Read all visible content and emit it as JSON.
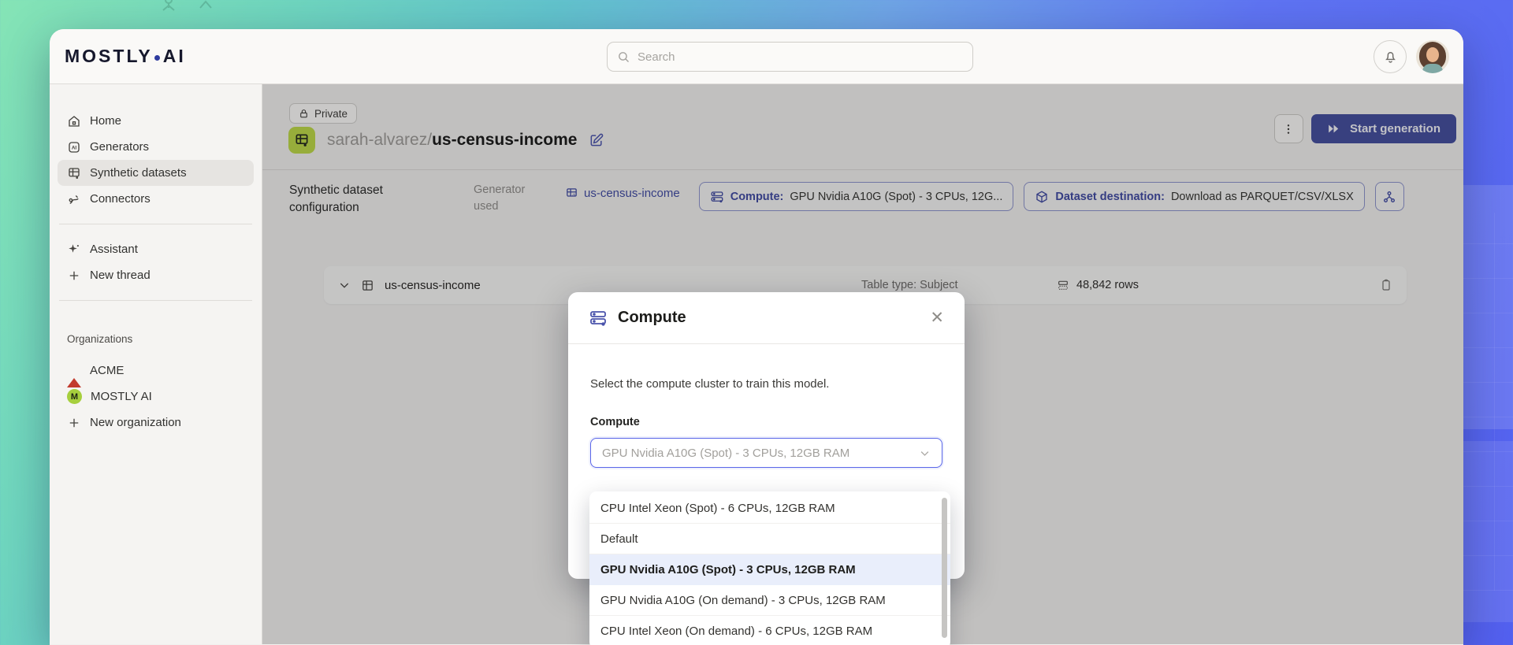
{
  "topbar": {
    "logo_left": "MOSTLY",
    "logo_right": "AI",
    "search_placeholder": "Search"
  },
  "sidebar": {
    "items": [
      {
        "label": "Home",
        "icon": "home-icon"
      },
      {
        "label": "Generators",
        "icon": "generators-icon"
      },
      {
        "label": "Synthetic datasets",
        "icon": "synthetic-datasets-icon",
        "active": true
      },
      {
        "label": "Connectors",
        "icon": "connectors-icon"
      }
    ],
    "assistant": {
      "label": "Assistant"
    },
    "new_thread": {
      "label": "New thread"
    },
    "organizations_label": "Organizations",
    "organizations": [
      {
        "label": "ACME",
        "badge": "acme-logo"
      },
      {
        "label": "MOSTLY AI",
        "badge": "M"
      }
    ],
    "new_organization": "New organization"
  },
  "page": {
    "privacy_badge": "Private",
    "title_owner": "sarah-alvarez/",
    "title_name": "us-census-income",
    "start_button": "Start generation",
    "config_heading": "Synthetic dataset configuration",
    "generator_used_label": "Generator used",
    "generator_link": "us-census-income",
    "compute_chip_label": "Compute:",
    "compute_chip_value": "GPU Nvidia A10G (Spot) - 3 CPUs, 12G...",
    "destination_chip_label": "Dataset destination:",
    "destination_chip_value": "Download as PARQUET/CSV/XLSX"
  },
  "table_row": {
    "name": "us-census-income",
    "type": "Table type: Subject",
    "rows": "48,842 rows"
  },
  "modal": {
    "title": "Compute",
    "close": "✕",
    "description": "Select the compute cluster to train this model.",
    "field_label": "Compute",
    "select_value": "GPU Nvidia A10G (Spot) - 3 CPUs, 12GB RAM",
    "options": [
      "CPU Intel Xeon (Spot) - 6 CPUs, 12GB RAM",
      "Default",
      "GPU Nvidia A10G (Spot) - 3 CPUs, 12GB RAM",
      "GPU Nvidia A10G (On demand) - 3 CPUs, 12GB RAM",
      "CPU Intel Xeon (On demand) - 6 CPUs, 12GB RAM"
    ],
    "selected_option_index": 2
  },
  "colors": {
    "accent_indigo": "#424c9c",
    "focus_blue": "#5b67e8",
    "brand_lime": "#bcd845",
    "option_highlight": "#e9eefb",
    "bg_green": "#85e4b6",
    "bg_blue": "#5360f0"
  }
}
